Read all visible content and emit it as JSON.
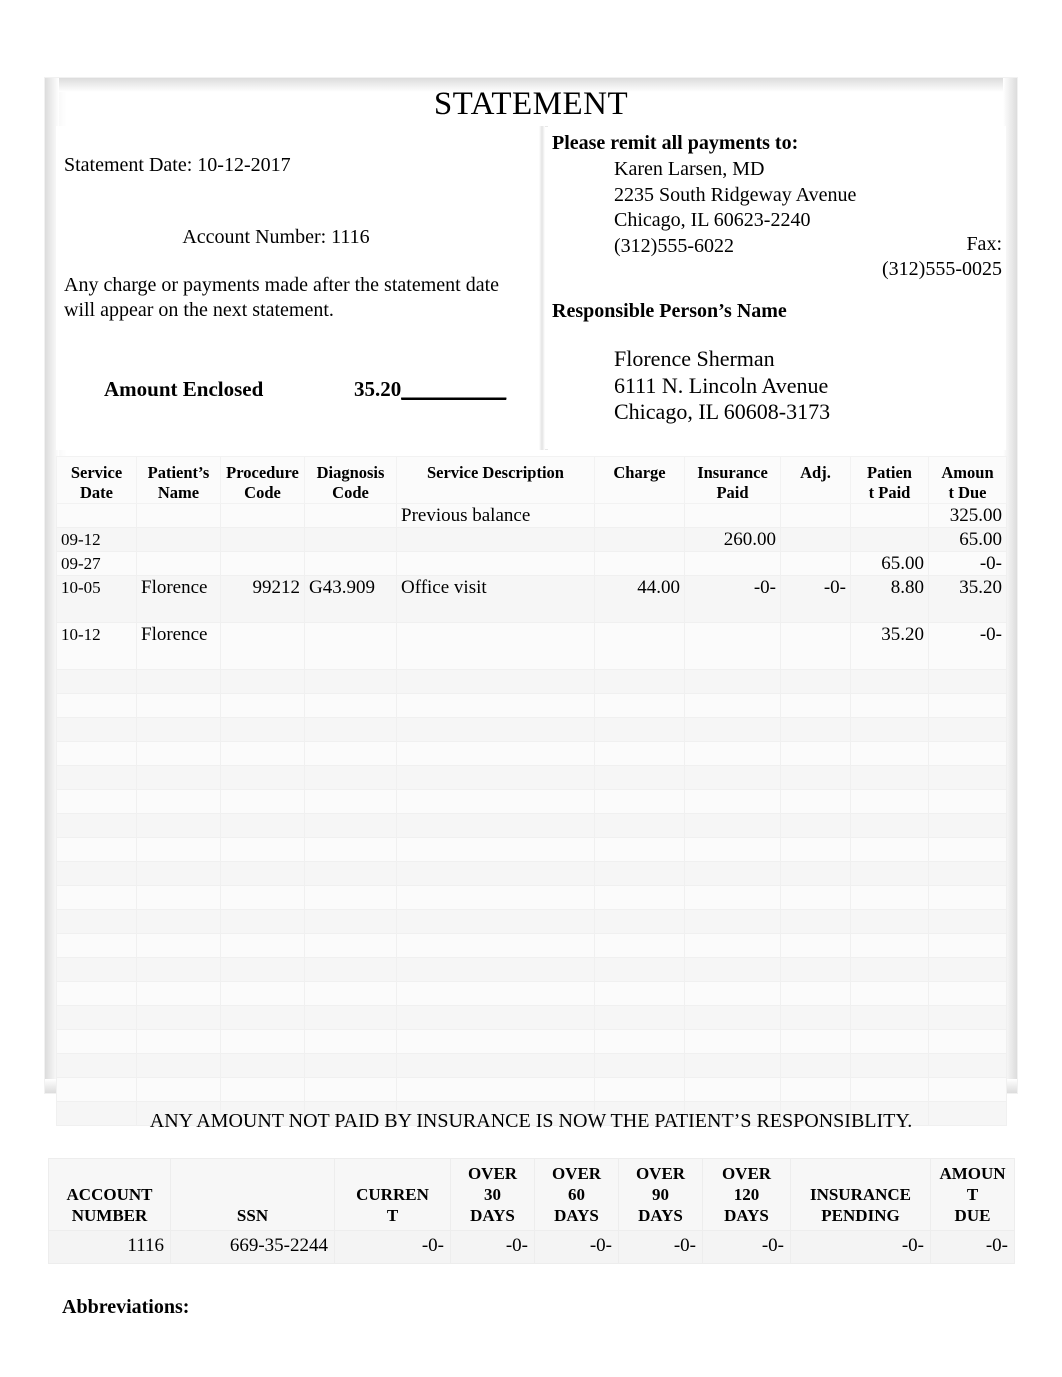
{
  "document": {
    "title": "STATEMENT"
  },
  "header_left": {
    "statement_date_label": "Statement Date: 10-12-2017",
    "account_number_label": "Account Number: 1116",
    "notice": "Any charge or payments made after the statement date will appear on the next statement.",
    "amount_enclosed_label": "Amount Enclosed",
    "amount_enclosed_value": "35.20",
    "amount_enclosed_blank": "__________"
  },
  "header_right": {
    "remit_title": "Please remit all payments to:",
    "provider_name": "Karen Larsen, MD",
    "provider_street": "2235 South Ridgeway Avenue",
    "provider_citystatezip": "Chicago, IL 60623-2240",
    "provider_phone": " (312)555-6022",
    "fax_label": "Fax:",
    "fax_number": "(312)555-0025",
    "responsible_title": "Responsible Person’s Name",
    "responsible_name": "Florence Sherman",
    "responsible_street": "6111 N. Lincoln Avenue",
    "responsible_citystatezip": "Chicago, IL 60608-3173"
  },
  "charges_table": {
    "columns": [
      "Service Date",
      "Patient’s Name",
      "Procedure Code",
      "Diagnosis Code",
      "Service Description",
      "Charge",
      "Insurance Paid",
      "Adj.",
      "Patien t Paid",
      "Amoun t Due"
    ],
    "columns_wrapped": [
      [
        "Service",
        "Date"
      ],
      [
        "Patient’s",
        "Name"
      ],
      [
        "Procedure",
        "Code"
      ],
      [
        "Diagnosis",
        "Code"
      ],
      [
        "Service Description"
      ],
      [
        "Charge"
      ],
      [
        "Insurance",
        "Paid"
      ],
      [
        "Adj."
      ],
      [
        "Patien",
        "t Paid"
      ],
      [
        "Amoun",
        "t Due"
      ]
    ],
    "rows": [
      {
        "service_date": "",
        "patient_name": "",
        "procedure_code": "",
        "diagnosis_code": "",
        "service_description": "Previous balance",
        "charge": "",
        "insurance_paid": "",
        "adj": "",
        "patient_paid": "",
        "amount_due": "325.00"
      },
      {
        "service_date": "09-12",
        "patient_name": "",
        "procedure_code": "",
        "diagnosis_code": "",
        "service_description": "",
        "charge": "",
        "insurance_paid": "260.00",
        "adj": "",
        "patient_paid": "",
        "amount_due": "65.00"
      },
      {
        "service_date": "09-27",
        "patient_name": "",
        "procedure_code": "",
        "diagnosis_code": "",
        "service_description": "",
        "charge": "",
        "insurance_paid": "",
        "adj": "",
        "patient_paid": "65.00",
        "amount_due": "-0-"
      },
      {
        "service_date": "10-05",
        "patient_name": "Florence",
        "procedure_code": "99212",
        "diagnosis_code": "G43.909",
        "service_description": "Office visit",
        "charge": "44.00",
        "insurance_paid": "-0-",
        "adj": "-0-",
        "patient_paid": "8.80",
        "amount_due": "35.20"
      },
      {
        "service_date": "10-12",
        "patient_name": "Florence",
        "procedure_code": "",
        "diagnosis_code": "",
        "service_description": "",
        "charge": "",
        "insurance_paid": "",
        "adj": "",
        "patient_paid": "35.20",
        "amount_due": "-0-"
      }
    ],
    "empty_row_count": 19
  },
  "responsibility_note": "ANY AMOUNT NOT PAID BY INSURANCE IS NOW THE PATIENT’S RESPONSIBLITY.",
  "aging_table": {
    "columns_wrapped": [
      [
        "ACCOUNT",
        "NUMBER"
      ],
      [
        "SSN"
      ],
      [
        "CURREN",
        "T"
      ],
      [
        "OVER",
        "30",
        "DAYS"
      ],
      [
        "OVER",
        "60",
        "DAYS"
      ],
      [
        "OVER",
        "90",
        "DAYS"
      ],
      [
        "OVER",
        "120",
        "DAYS"
      ],
      [
        "INSURANCE",
        "PENDING"
      ],
      [
        "AMOUNT",
        "DUE"
      ]
    ],
    "values": [
      "1116",
      "669-35-2244",
      "-0-",
      "-0-",
      "-0-",
      "-0-",
      "-0-",
      "-0-",
      "-0-"
    ]
  },
  "footer": {
    "abbreviations_label": "Abbreviations:"
  }
}
